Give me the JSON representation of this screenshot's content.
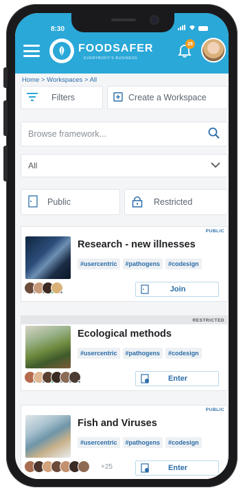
{
  "status_bar": {
    "time": "8:30"
  },
  "header": {
    "brand": "FOODSAFER",
    "tagline": "EVERYBODY'S BUSINESS",
    "notification_count": "28"
  },
  "breadcrumb": "Home > Workspaces > All",
  "toolbar": {
    "filters_label": "Filters",
    "create_label": "Create a Workspace"
  },
  "search": {
    "placeholder": "Browse framework..."
  },
  "select": {
    "value": "All"
  },
  "visibility_tabs": {
    "public_label": "Public",
    "restricted_label": "Restricted"
  },
  "cards": [
    {
      "visibility": "PUBLIC",
      "title": "Research - new illnesses",
      "tags": [
        "#usercentric",
        "#pathogens",
        "#codesign"
      ],
      "action": "Join",
      "more": ""
    },
    {
      "visibility": "RESTRICTED",
      "title": "Ecological methods",
      "tags": [
        "#usercentric",
        "#pathogens",
        "#codesign"
      ],
      "action": "Enter",
      "more": ""
    },
    {
      "visibility": "PUBLIC",
      "title": "Fish and Viruses",
      "tags": [
        "#usercentric",
        "#pathogens",
        "#codesign"
      ],
      "action": "Enter",
      "more": "+25"
    }
  ],
  "colors": {
    "brand": "#2aa8d8",
    "accent": "#2b6da8",
    "badge": "#f29b1d"
  }
}
